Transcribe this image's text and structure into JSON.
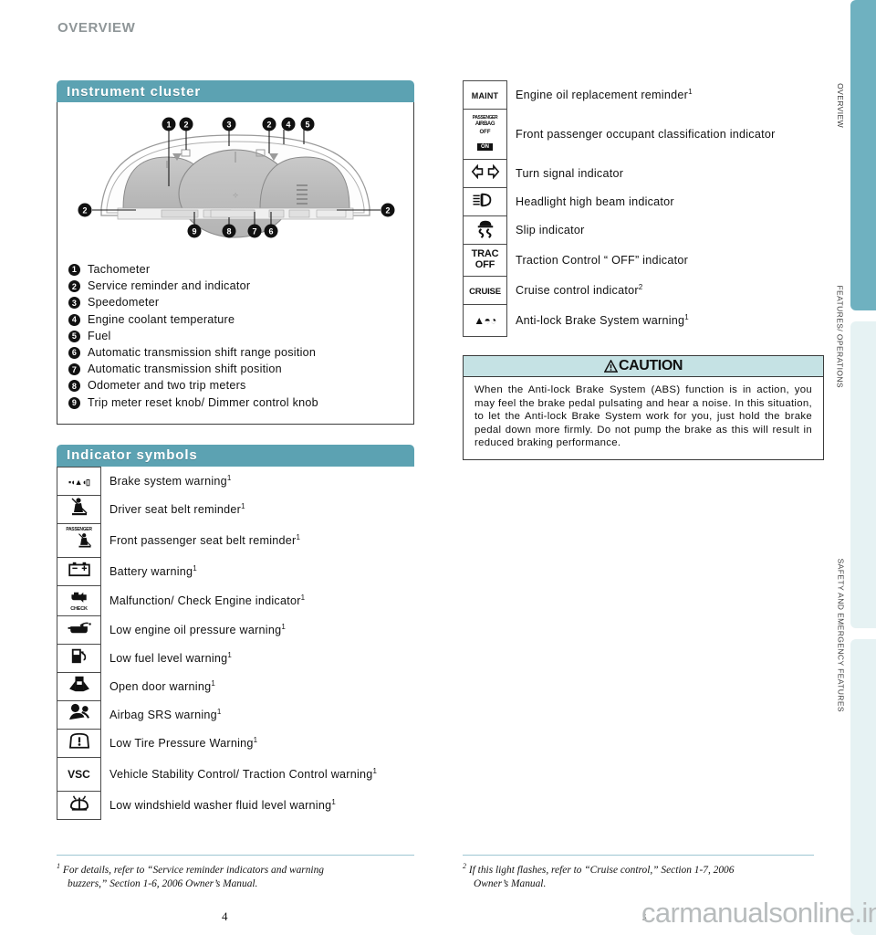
{
  "page": {
    "heading": "OVERVIEW",
    "page_number_left": "4",
    "page_number_right": "5",
    "watermark": "carmanualsonline.info"
  },
  "side_tabs": [
    {
      "label": "OVERVIEW",
      "active": true,
      "color": "#6fb1c0"
    },
    {
      "label": "FEATURES/ OPERATIONS",
      "active": false,
      "color": "#e6f2f3"
    },
    {
      "label": "SAFETY AND EMERGENCY FEATURES",
      "active": false,
      "color": "#e6f2f3"
    }
  ],
  "colors": {
    "banner_teal": "#5ca2b2",
    "tab_active": "#6fb1c0",
    "tab_inactive": "#e6f2f3",
    "caution_band": "#c5e2e4",
    "heading_gray": "#8f9698"
  },
  "instrument_cluster": {
    "title": "Instrument cluster",
    "callouts_top": [
      "1",
      "2",
      "3",
      "2",
      "4",
      "5"
    ],
    "callouts_side": [
      "2",
      "2"
    ],
    "callouts_bottom": [
      "9",
      "8",
      "7",
      "6"
    ],
    "items": [
      {
        "n": "1",
        "label": "Tachometer"
      },
      {
        "n": "2",
        "label": "Service reminder and indicator"
      },
      {
        "n": "3",
        "label": "Speedometer"
      },
      {
        "n": "4",
        "label": "Engine coolant temperature"
      },
      {
        "n": "5",
        "label": "Fuel"
      },
      {
        "n": "6",
        "label": "Automatic transmission shift range position"
      },
      {
        "n": "7",
        "label": "Automatic transmission shift position"
      },
      {
        "n": "8",
        "label": "Odometer and two trip meters"
      },
      {
        "n": "9",
        "label": "Trip meter reset knob/ Dimmer control knob"
      }
    ]
  },
  "indicator_symbols": {
    "title": "Indicator symbols",
    "left_rows": [
      {
        "icon": "brake-warning-icon",
        "icon_text": "BRAKE",
        "label": "Brake system warning",
        "note": "1"
      },
      {
        "icon": "driver-seat-belt-icon",
        "icon_text": "",
        "label": "Driver seat belt reminder",
        "note": "1"
      },
      {
        "icon": "passenger-seat-belt-icon",
        "icon_text": "PASSENGER",
        "label": "Front passenger seat belt reminder",
        "note": "1"
      },
      {
        "icon": "battery-icon",
        "icon_text": "",
        "label": "Battery warning",
        "note": "1"
      },
      {
        "icon": "check-engine-icon",
        "icon_text": "CHECK",
        "label": "Malfunction/ Check Engine indicator",
        "note": "1"
      },
      {
        "icon": "oil-pressure-icon",
        "icon_text": "",
        "label": "Low engine oil pressure warning",
        "note": "1"
      },
      {
        "icon": "low-fuel-icon",
        "icon_text": "",
        "label": "Low fuel level warning",
        "note": "1"
      },
      {
        "icon": "open-door-icon",
        "icon_text": "",
        "label": "Open door warning",
        "note": "1"
      },
      {
        "icon": "airbag-srs-icon",
        "icon_text": "",
        "label": "Airbag SRS warning",
        "note": "1"
      },
      {
        "icon": "low-tire-pressure-icon",
        "icon_text": "",
        "label": "Low Tire Pressure Warning",
        "note": "1"
      },
      {
        "icon": "vsc-icon",
        "icon_text": "VSC",
        "label": "Vehicle Stability Control/ Traction Control warning",
        "note": "1"
      },
      {
        "icon": "washer-fluid-icon",
        "icon_text": "",
        "label": "Low windshield washer fluid level warning",
        "note": "1"
      }
    ],
    "right_rows": [
      {
        "icon": "maint-icon",
        "icon_text": "MAINT",
        "label": "Engine oil replacement reminder",
        "note": "1"
      },
      {
        "icon": "passenger-airbag-off-icon",
        "icon_text": "PASSENGER AIRBAG OFF ON",
        "label": "Front passenger occupant classification indicator",
        "note": ""
      },
      {
        "icon": "turn-signal-icon",
        "icon_text": "",
        "label": "Turn signal indicator",
        "note": ""
      },
      {
        "icon": "high-beam-icon",
        "icon_text": "",
        "label": "Headlight high beam indicator",
        "note": ""
      },
      {
        "icon": "slip-indicator-icon",
        "icon_text": "",
        "label": "Slip indicator",
        "note": ""
      },
      {
        "icon": "trac-off-icon",
        "icon_text": "TRAC OFF",
        "label": "Traction Control “ OFF” indicator",
        "note": ""
      },
      {
        "icon": "cruise-icon",
        "icon_text": "CRUISE",
        "label": "Cruise control indicator",
        "note": "2"
      },
      {
        "icon": "abs-icon",
        "icon_text": "ABS",
        "label": "Anti-lock Brake System warning",
        "note": "1"
      }
    ]
  },
  "caution": {
    "title": "CAUTION",
    "body": "When the Anti-lock Brake System (ABS) function is in action, you may feel the brake pedal pulsating and hear a noise. In this situation, to let the Anti-lock Brake System work for you, just hold the brake pedal down more firmly. Do not pump the brake as this will result in reduced braking performance."
  },
  "footnotes": {
    "left_marker": "1",
    "left_line1": "For details, refer to “Service reminder indicators and warning",
    "left_line2": "buzzers,” Section 1-6, 2006 Owner’s Manual.",
    "right_marker": "2",
    "right_line1": "If this light flashes, refer to “Cruise control,” Section 1-7, 2006",
    "right_line2": "Owner’s Manual."
  }
}
